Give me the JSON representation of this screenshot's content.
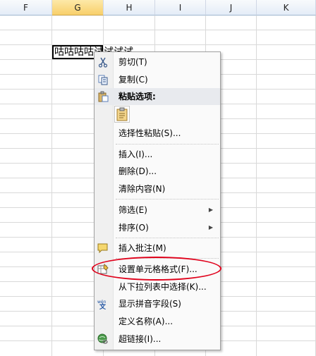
{
  "columns": [
    "F",
    "G",
    "H",
    "I",
    "J",
    "K"
  ],
  "selected_column": "G",
  "active_cell_text": "咕咕咕咕试试试试",
  "context_menu": {
    "items": [
      {
        "label": "剪切(T)",
        "icon": "scissors-icon"
      },
      {
        "label": "复制(C)",
        "icon": "copy-icon"
      },
      {
        "label": "粘贴选项:",
        "icon": "paste-icon",
        "header": true
      },
      {
        "label": "选择性粘贴(S)...",
        "icon": ""
      },
      {
        "label": "插入(I)...",
        "icon": ""
      },
      {
        "label": "删除(D)...",
        "icon": ""
      },
      {
        "label": "清除内容(N)",
        "icon": ""
      },
      {
        "label": "筛选(E)",
        "icon": "",
        "submenu": true
      },
      {
        "label": "排序(O)",
        "icon": "",
        "submenu": true
      },
      {
        "label": "插入批注(M)",
        "icon": "comment-icon"
      },
      {
        "label": "设置单元格格式(F)...",
        "icon": "format-cells-icon"
      },
      {
        "label": "从下拉列表中选择(K)...",
        "icon": ""
      },
      {
        "label": "显示拼音字段(S)",
        "icon": "phonetic-icon"
      },
      {
        "label": "定义名称(A)...",
        "icon": ""
      },
      {
        "label": "超链接(I)...",
        "icon": "hyperlink-icon"
      }
    ]
  },
  "submenu_arrow": "▶",
  "highlight_color": "#e0001a"
}
